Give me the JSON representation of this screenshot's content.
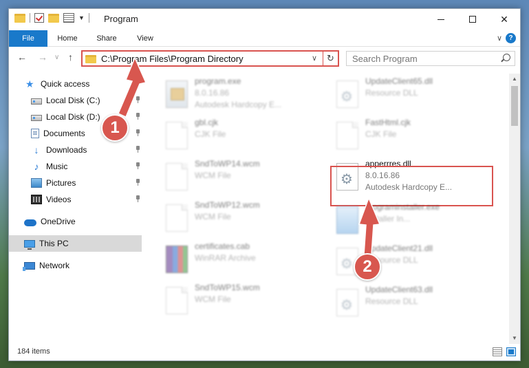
{
  "window": {
    "title": "Program",
    "controls": {
      "minimize": "",
      "maximize": "",
      "close": "✕"
    }
  },
  "ribbon": {
    "tabs": [
      "File",
      "Home",
      "Share",
      "View"
    ],
    "help": "?"
  },
  "address": {
    "path": "C:\\Program Files\\Program Directory",
    "search_placeholder": "Search Program"
  },
  "sidebar": {
    "items": [
      {
        "label": "Quick access",
        "icon": "star-icon"
      },
      {
        "label": "Local Disk (C:)",
        "icon": "drive-icon",
        "pinned": true
      },
      {
        "label": "Local Disk (D:)",
        "icon": "drive-icon",
        "pinned": true
      },
      {
        "label": "Documents",
        "icon": "documents-icon",
        "pinned": true
      },
      {
        "label": "Downloads",
        "icon": "downloads-icon",
        "pinned": true
      },
      {
        "label": "Music",
        "icon": "music-icon",
        "pinned": true
      },
      {
        "label": "Pictures",
        "icon": "pictures-icon",
        "pinned": true
      },
      {
        "label": "Videos",
        "icon": "videos-icon",
        "pinned": true
      },
      {
        "label": "OneDrive",
        "icon": "onedrive-icon"
      },
      {
        "label": "This PC",
        "icon": "pc-icon",
        "selected": true
      },
      {
        "label": "Network",
        "icon": "network-icon"
      }
    ]
  },
  "files": [
    {
      "name": "program.exe",
      "line1": "8.0.16.86",
      "line2": "Autodesk Hardcopy E...",
      "icon": "exe"
    },
    {
      "name": "UpdateClient65.dll",
      "line1": "Resource DLL",
      "line2": "",
      "icon": "gear"
    },
    {
      "name": "gbl.cjk",
      "line1": "CJK File",
      "line2": "",
      "icon": "doc"
    },
    {
      "name": "FastHtml.cjk",
      "line1": "CJK File",
      "line2": "",
      "icon": "doc"
    },
    {
      "name": "SndToWP14.wcm",
      "line1": "WCM File",
      "line2": "",
      "icon": "doc"
    },
    {
      "name": "apperrres.dll",
      "line1": "8.0.16.86",
      "line2": "Autodesk Hardcopy E...",
      "icon": "gear",
      "highlighted": true
    },
    {
      "name": "SndToWP12.wcm",
      "line1": "WCM File",
      "line2": "",
      "icon": "doc"
    },
    {
      "name": "programinstaller.exe",
      "line1": "Installer In...",
      "line2": "",
      "icon": "inst"
    },
    {
      "name": "certificates.cab",
      "line1": "WinRAR Archive",
      "line2": "",
      "icon": "rar"
    },
    {
      "name": "UpdateClient21.dll",
      "line1": "Resource DLL",
      "line2": "",
      "icon": "gear"
    },
    {
      "name": "SndToWP15.wcm",
      "line1": "WCM File",
      "line2": "",
      "icon": "doc"
    },
    {
      "name": "UpdateClient63.dll",
      "line1": "Resource DLL",
      "line2": "",
      "icon": "gear"
    }
  ],
  "status": {
    "item_count": "184 items"
  },
  "annotations": {
    "step1": "1",
    "step2": "2",
    "color": "#d8574f"
  }
}
